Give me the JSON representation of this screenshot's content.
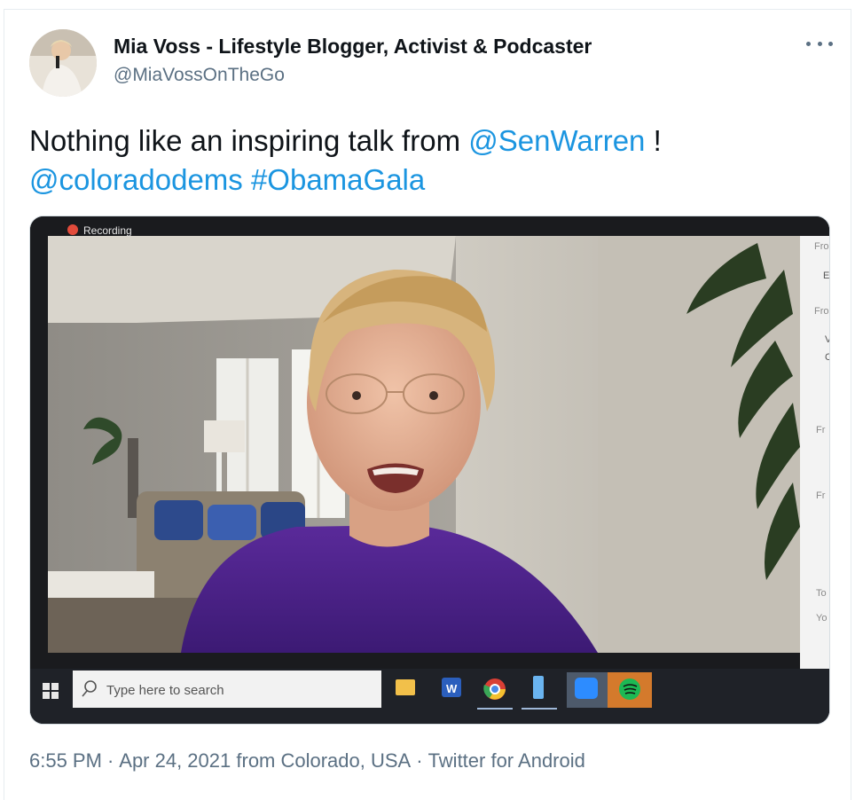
{
  "tweet": {
    "author_name": "Mia Voss - Lifestyle Blogger, Activist & Podcaster",
    "author_handle": "@MiaVossOnTheGo",
    "text_start": "Nothing like an inspiring talk from ",
    "mention_1": "@SenWarren",
    "text_mid": " !",
    "mention_2": "@coloradodems",
    "hashtag": "#ObamaGala",
    "time": "6:55 PM",
    "date": "Apr 24, 2021",
    "location": "from Colorado, USA",
    "source": "Twitter for Android",
    "separator": "·"
  },
  "media": {
    "recording_label": "Recording",
    "taskbar_search_placeholder": "Type here to search",
    "side_panel_fragments": [
      "Fro",
      "E",
      "Fro",
      "V",
      "C",
      "Fr",
      "Fr",
      "To",
      "Yo"
    ],
    "taskbar_icons": [
      "windows-icon",
      "file-explorer-icon",
      "word-icon",
      "chrome-icon",
      "phone-icon",
      "zoom-icon",
      "spotify-icon"
    ]
  },
  "colors": {
    "link": "#1b95e0",
    "muted": "#5b7083",
    "text": "#0f1419",
    "purple_top": "#5a2a9a"
  }
}
